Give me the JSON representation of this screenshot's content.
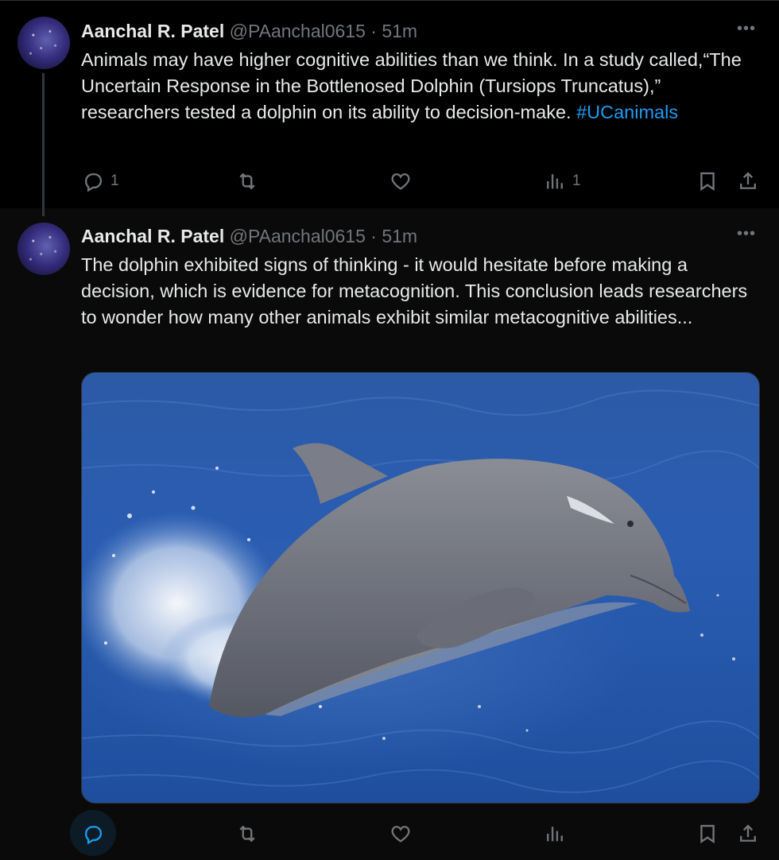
{
  "tweets": [
    {
      "author": {
        "name": "Aanchal R. Patel",
        "handle": "@PAanchal0615"
      },
      "separator": "·",
      "time": "51m",
      "text_before": "Animals may have higher cognitive abilities than we think. In a study called,“The Uncertain Response in the Bottlenosed Dolphin (Tursiops Truncatus),” researchers tested a dolphin on its ability to decision-make.",
      "hashtag": "#UCanimals",
      "more_label": "•••",
      "stats": {
        "replies": "1",
        "retweets": "",
        "likes": "",
        "views": "1"
      },
      "icons": {
        "reply": "reply-icon",
        "retweet": "retweet-icon",
        "like": "heart-icon",
        "views": "views-icon",
        "bookmark": "bookmark-icon",
        "share": "share-icon"
      }
    },
    {
      "author": {
        "name": "Aanchal R. Patel",
        "handle": "@PAanchal0615"
      },
      "separator": "·",
      "time": "51m",
      "text": "The dolphin exhibited signs of thinking - it would hesitate before making a decision, which is evidence for metacognition. This conclusion leads researchers to wonder how many other animals exhibit similar metacognitive abilities...",
      "more_label": "•••",
      "media": {
        "subject": "dolphin-photo"
      },
      "stats": {
        "replies": "",
        "retweets": "",
        "likes": "",
        "views": ""
      },
      "active_action": "reply"
    }
  ],
  "colors": {
    "background": "#000000",
    "text": "#e7e9ea",
    "muted": "#71767b",
    "accent": "#1d9bf0",
    "divider": "#2f3336"
  }
}
